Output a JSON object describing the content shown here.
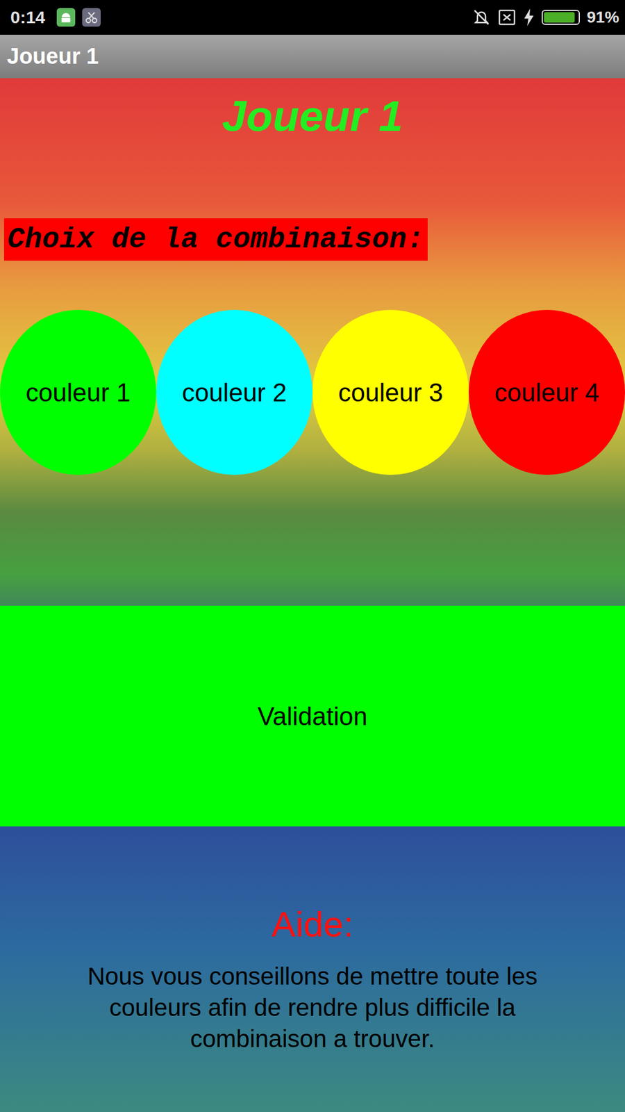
{
  "status_bar": {
    "time": "0:14",
    "battery": {
      "level": 0.91,
      "reading": "91%"
    }
  },
  "action_bar": {
    "title": "Joueur 1"
  },
  "heading": "Joueur 1",
  "section_label": "Choix de la combinaison:",
  "colors": [
    {
      "label": "couleur 1",
      "color": "#00ff00"
    },
    {
      "label": "couleur 2",
      "color": "#00ffff"
    },
    {
      "label": "couleur 3",
      "color": "#ffff00"
    },
    {
      "label": "couleur 4",
      "color": "#ff0000"
    }
  ],
  "validate_button": "Validation",
  "help": {
    "title": "Aide:",
    "text": "Nous vous conseillons de mettre toute les couleurs afin de rendre plus difficile la combinaison a trouver."
  }
}
